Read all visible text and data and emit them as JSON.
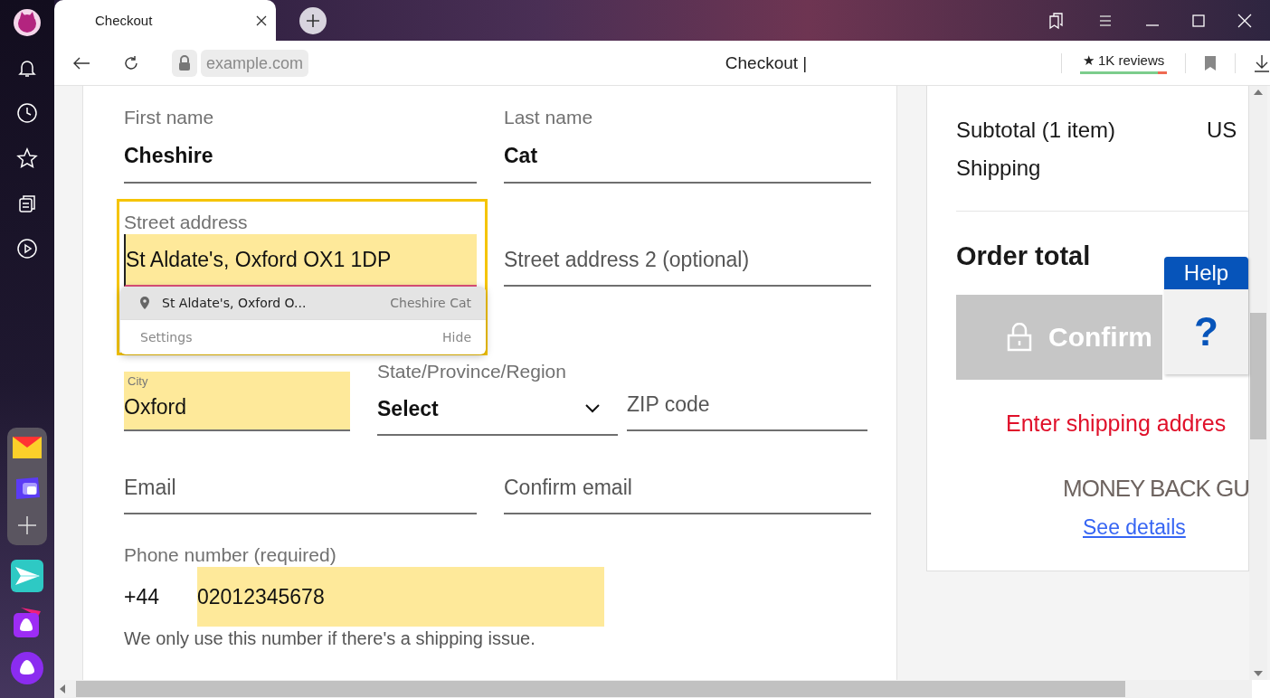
{
  "browser": {
    "tab": {
      "title": "Checkout",
      "selected": true
    },
    "url": "example.com",
    "page_title": "Checkout |",
    "reviews": {
      "label": "★ 1K reviews",
      "level": 0.9
    }
  },
  "form": {
    "first_name": {
      "label": "First name",
      "value": "Cheshire"
    },
    "last_name": {
      "label": "Last name",
      "value": "Cat"
    },
    "street": {
      "label": "Street address",
      "value": "St Aldate's, Oxford OX1 1DP",
      "autofilled": true,
      "focused": true
    },
    "street2": {
      "placeholder": "Street address 2 (optional)"
    },
    "city": {
      "placeholder": "City",
      "value": "Oxford",
      "autofilled": true
    },
    "state": {
      "label": "State/Province/Region",
      "value": "Select"
    },
    "zip": {
      "placeholder": "ZIP code"
    },
    "email": {
      "placeholder": "Email"
    },
    "confirm_email": {
      "placeholder": "Confirm email"
    },
    "phone": {
      "label": "Phone number (required)",
      "prefix": "+44",
      "value": "02012345678",
      "autofilled": true,
      "hint": "We only use this number if there's a shipping issue."
    }
  },
  "autofill": {
    "suggestions": [
      {
        "address": "St Aldate's, Oxford O...",
        "name": "Cheshire Cat",
        "selected": true
      }
    ],
    "settings": "Settings",
    "hide": "Hide"
  },
  "summary": {
    "lines": [
      {
        "label": "Subtotal (1 item)",
        "value": "US"
      },
      {
        "label": "Shipping"
      }
    ],
    "total": {
      "label": "Order total"
    },
    "confirm": {
      "label": "Confirm",
      "disabled": true
    },
    "error": "Enter shipping addres",
    "guarantee": "MONEY BACK GU",
    "details_link": "See details"
  },
  "help": {
    "title": "Help",
    "icon": "?"
  }
}
